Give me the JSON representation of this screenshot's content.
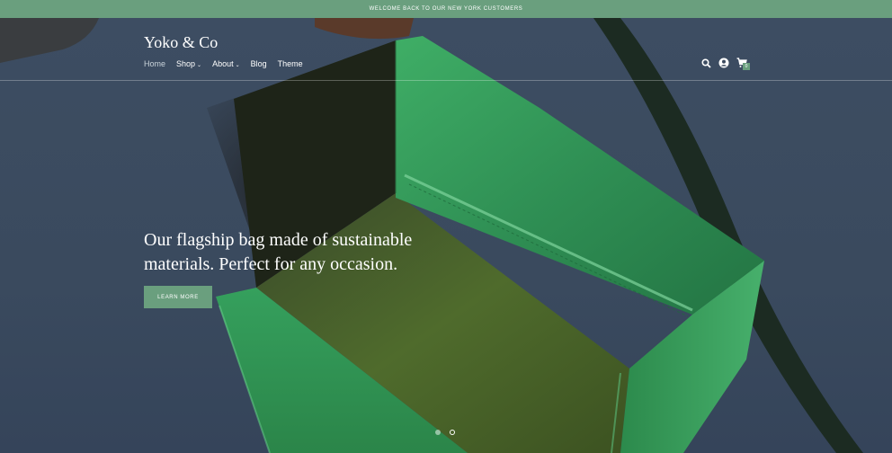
{
  "announcement": {
    "text": "WELCOME BACK TO OUR NEW YORK CUSTOMERS"
  },
  "header": {
    "logo": "Yoko & Co",
    "nav": [
      {
        "label": "Home",
        "active": true,
        "has_dropdown": false
      },
      {
        "label": "Shop",
        "active": false,
        "has_dropdown": true
      },
      {
        "label": "About",
        "active": false,
        "has_dropdown": true
      },
      {
        "label": "Blog",
        "active": false,
        "has_dropdown": false
      },
      {
        "label": "Theme",
        "active": false,
        "has_dropdown": false
      }
    ],
    "icons": [
      "search-icon",
      "account-icon",
      "cart-icon"
    ],
    "cart_count": "0"
  },
  "hero": {
    "headline": "Our flagship bag made of sustainable materials. Perfect for any occasion.",
    "cta_label": "LEARN MORE",
    "slides_total": 2,
    "slide_active": 2
  },
  "colors": {
    "accent": "#6a9f7e",
    "background": "#3b4a5e",
    "bag_green": "#2f8a4f"
  }
}
